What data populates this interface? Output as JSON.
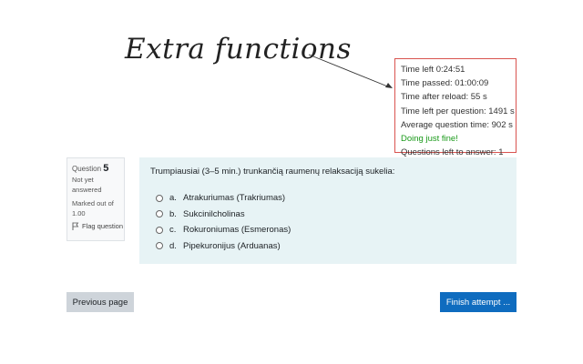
{
  "annotation": {
    "text": "Extra functions"
  },
  "timer": {
    "lines": [
      "Time left 0:24:51",
      "Time passed: 01:00:09",
      "Time after reload: 55 s",
      "Time left per question: 1491 s",
      "Average question time: 902 s",
      "Doing just fine!",
      "Questions left to answer: 1"
    ],
    "status_color": "#1a9a1a",
    "border_color": "#d9534f"
  },
  "question_info": {
    "label": "Question",
    "number": "5",
    "status": "Not yet answered",
    "mark_label": "Marked out of 1.00",
    "flag_label": "Flag question",
    "flag_icon": "flag-icon"
  },
  "question": {
    "text": "Trumpiausiai (3–5 min.) trunkančią raumenų relaksaciją sukelia:",
    "answers": [
      {
        "letter": "a.",
        "label": "Atrakuriumas (Trakriumas)"
      },
      {
        "letter": "b.",
        "label": "Sukcinilcholinas"
      },
      {
        "letter": "c.",
        "label": "Rokuroniumas (Esmeronas)"
      },
      {
        "letter": "d.",
        "label": "Pipekuronijus (Arduanas)"
      }
    ]
  },
  "navigation": {
    "prev_label": "Previous page",
    "finish_label": "Finish attempt ..."
  },
  "colors": {
    "accent": "#0f6cbf",
    "question_bg": "#e7f3f5",
    "secondary_button": "#ced4da"
  }
}
